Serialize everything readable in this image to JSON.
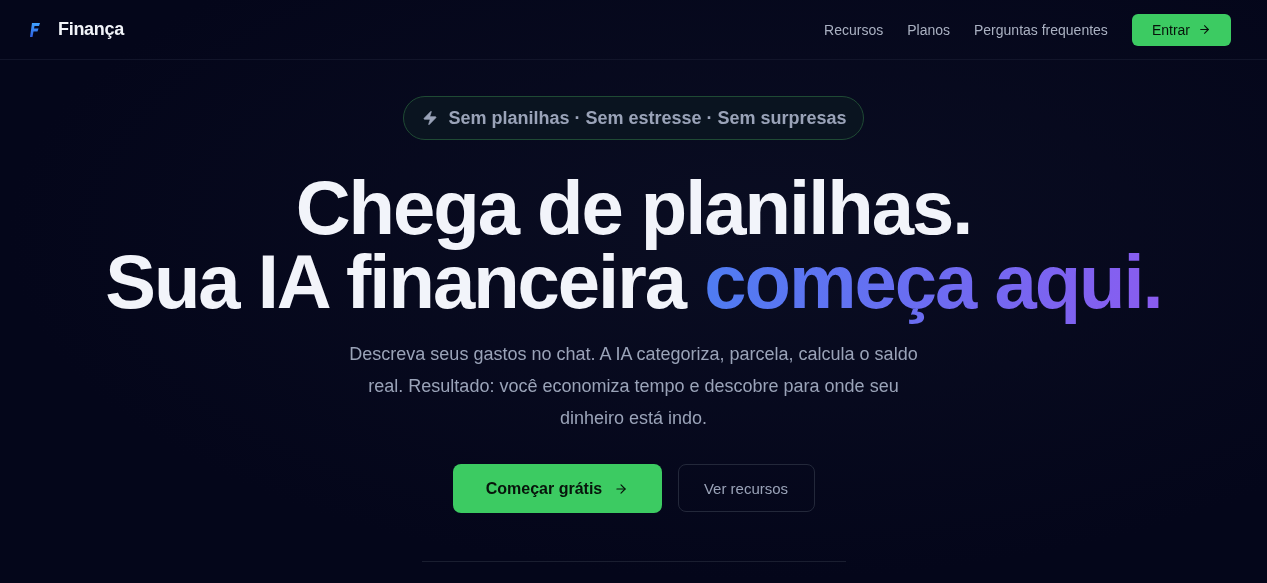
{
  "brand": {
    "name": "Finança"
  },
  "nav": {
    "links": [
      "Recursos",
      "Planos",
      "Perguntas frequentes"
    ],
    "cta": "Entrar"
  },
  "badge": {
    "text": "Sem planilhas · Sem estresse · Sem surpresas"
  },
  "headline": {
    "line_1": "Chega de planilhas.",
    "line_2": "Sua IA financeira",
    "highlight": "começa aqui."
  },
  "description": "Descreva seus gastos no chat. A IA categoriza, parcela, calcula o saldo real. Resultado: você economiza tempo e descobre para onde seu dinheiro está indo.",
  "buttons": {
    "primary": "Começar grátis",
    "secondary": "Ver recursos"
  }
}
